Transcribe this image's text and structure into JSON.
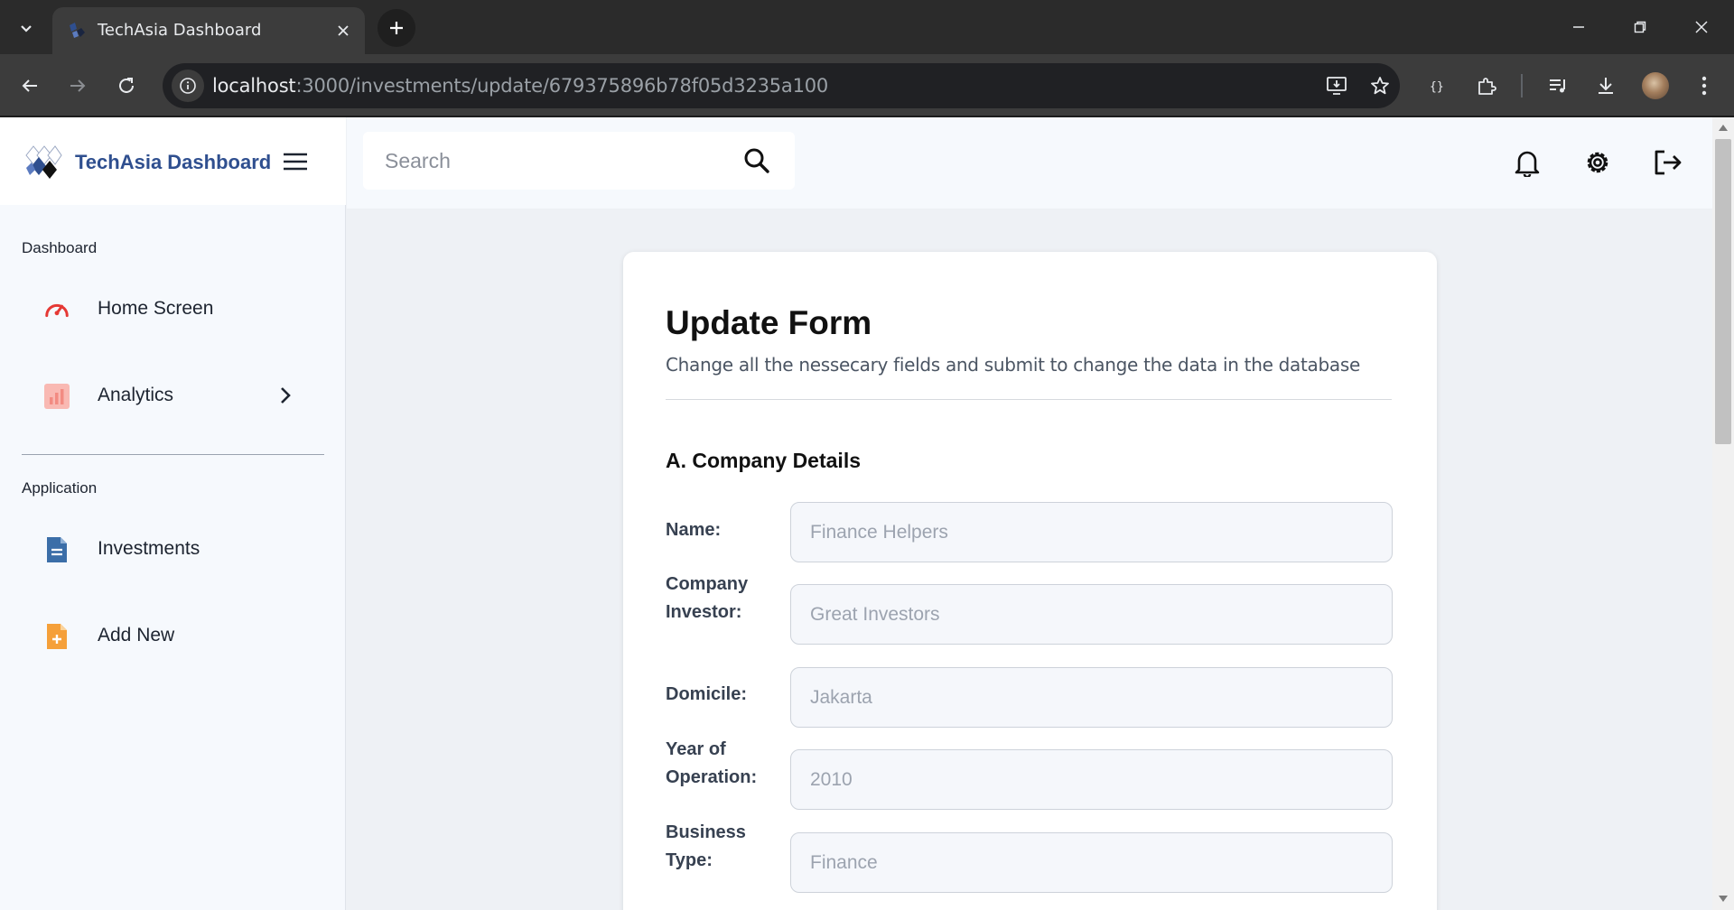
{
  "browser": {
    "tab_title": "TechAsia Dashboard",
    "url_host": "localhost",
    "url_path": ":3000/investments/update/679375896b78f05d3235a100"
  },
  "app": {
    "brand_name": "TechAsia Dashboard",
    "search_placeholder": "Search",
    "sidebar": {
      "sections": [
        {
          "title": "Dashboard",
          "items": [
            {
              "label": "Home Screen",
              "icon": "speedometer-icon",
              "color": "#e53935"
            },
            {
              "label": "Analytics",
              "icon": "bar-chart-icon",
              "color": "#f28b82",
              "has_submenu": true
            }
          ]
        },
        {
          "title": "Application",
          "items": [
            {
              "label": "Investments",
              "icon": "document-icon",
              "color": "#3b6ea8"
            },
            {
              "label": "Add New",
              "icon": "file-plus-icon",
              "color": "#f5a03a"
            }
          ]
        }
      ]
    },
    "top_actions": [
      "bell-icon",
      "gear-icon",
      "logout-icon"
    ]
  },
  "form": {
    "title": "Update Form",
    "subtitle": "Change all the nessecary fields and submit to change the data in the database",
    "section_title": "A. Company Details",
    "fields": [
      {
        "label": "Name:",
        "placeholder": "Finance Helpers",
        "value": ""
      },
      {
        "label": "Company Investor:",
        "placeholder": "Great Investors",
        "value": ""
      },
      {
        "label": "Domicile:",
        "placeholder": "Jakarta",
        "value": ""
      },
      {
        "label": "Year of Operation:",
        "placeholder": "2010",
        "value": ""
      },
      {
        "label": "Business Type:",
        "placeholder": "Finance",
        "value": ""
      }
    ]
  }
}
